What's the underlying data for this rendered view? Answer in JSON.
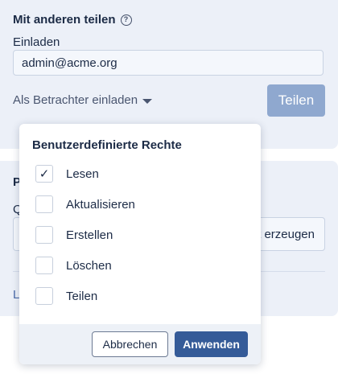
{
  "share": {
    "title": "Mit anderen teilen",
    "help_icon": "help-circle-icon",
    "invite_label": "Einladen",
    "invite_value": "admin@acme.org",
    "role_dropdown_label": "Als Betrachter einladen",
    "share_button_label": "Teilen"
  },
  "link_panel": {
    "title_visible_part": "P",
    "label_visible_part": "Q",
    "create_link_visible_part": "t erzeugen",
    "footer_visible_part": "L"
  },
  "permissions_popover": {
    "title": "Benutzerdefinierte Rechte",
    "options": [
      {
        "label": "Lesen",
        "checked": true
      },
      {
        "label": "Aktualisieren",
        "checked": false
      },
      {
        "label": "Erstellen",
        "checked": false
      },
      {
        "label": "Löschen",
        "checked": false
      },
      {
        "label": "Teilen",
        "checked": false
      }
    ],
    "cancel_label": "Abbrechen",
    "apply_label": "Anwenden"
  },
  "colors": {
    "panel_bg": "#ecf0f8",
    "primary": "#355b98",
    "primary_disabled": "#8fa8cf",
    "text": "#1c2b46"
  }
}
